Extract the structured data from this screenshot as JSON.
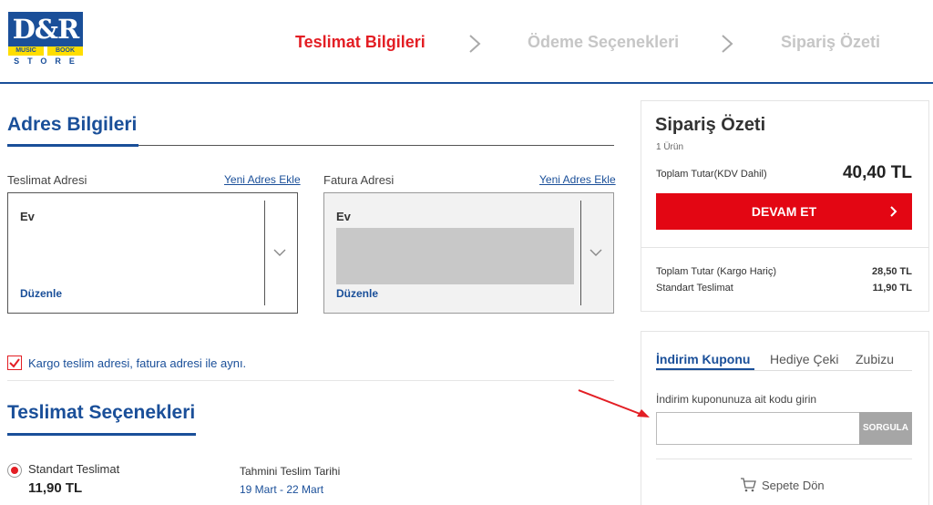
{
  "brand": {
    "logo_main": "D&R",
    "logo_music": "MUSIC",
    "logo_book": "BOOK",
    "logo_store": "STORE"
  },
  "steps": [
    {
      "label": "Teslimat Bilgileri",
      "state": "active"
    },
    {
      "label": "Ödeme Seçenekleri",
      "state": "inactive"
    },
    {
      "label": "Sipariş Özeti",
      "state": "inactive"
    }
  ],
  "address": {
    "title": "Adres Bilgileri",
    "delivery": {
      "label": "Teslimat Adresi",
      "add_link": "Yeni Adres Ekle",
      "name": "Ev",
      "edit": "Düzenle"
    },
    "invoice": {
      "label": "Fatura Adresi",
      "add_link": "Yeni Adres Ekle",
      "name": "Ev",
      "edit": "Düzenle"
    },
    "same_address_label": "Kargo teslim adresi, fatura adresi ile aynı.",
    "same_address_checked": true
  },
  "shipping": {
    "title": "Teslimat Seçenekleri",
    "option_name": "Standart Teslimat",
    "option_price": "11,90 TL",
    "eta_label": "Tahmini Teslim Tarihi",
    "eta_value": "19 Mart - 22 Mart"
  },
  "summary": {
    "title": "Sipariş Özeti",
    "item_count": "1 Ürün",
    "total_label": "Toplam Tutar(KDV Dahil)",
    "total_value": "40,40 TL",
    "cta_label": "DEVAM ET",
    "lines": [
      {
        "label": "Toplam Tutar (Kargo Hariç)",
        "value": "28,50 TL"
      },
      {
        "label": "Standart Teslimat",
        "value": "11,90 TL"
      }
    ]
  },
  "coupon": {
    "tabs": [
      "İndirim Kuponu",
      "Hediye Çeki",
      "Zubizu"
    ],
    "active_tab": 0,
    "input_label": "İndirim kuponunuza ait kodu girin",
    "input_value": "",
    "button_label": "SORGULA",
    "back_to_cart": "Sepete Dön"
  },
  "colors": {
    "brand_blue": "#1a4f99",
    "accent_red": "#e30613",
    "inactive_grey": "#c6c6c6"
  }
}
